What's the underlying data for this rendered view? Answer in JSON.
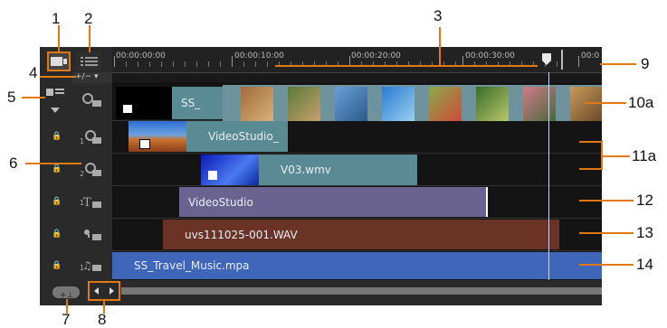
{
  "callouts": {
    "c1": "1",
    "c2": "2",
    "c3": "3",
    "c4": "4",
    "c5": "5",
    "c6": "6",
    "c7": "7",
    "c8": "8",
    "c9": "9",
    "c10a": "10a",
    "c11a": "11a",
    "c12": "12",
    "c13": "13",
    "c14": "14"
  },
  "ruler": {
    "t0": "00:00:00:00",
    "t1": "00:00:10:00",
    "t2": "00:00:20:00",
    "t3": "00:00:30:00",
    "t4": "00:0"
  },
  "zoom_label": "+/− ▾",
  "clips": {
    "video_title": "SS_",
    "overlay1": "VideoStudio_",
    "overlay2": "V03.wmv",
    "title": "VideoStudio",
    "voice": "uvs111025-001.WAV",
    "music": "SS_Travel_Music.mpa"
  },
  "track_numbers": {
    "overlay1": "1",
    "overlay2": "2",
    "title": "1",
    "music": "1"
  },
  "colors": {
    "video": "#5a8a93",
    "overlay": "#5a8a93",
    "title": "#6a6390",
    "voice": "#6a3326",
    "music": "#3f66b8",
    "callout_line": "#e07a10"
  }
}
